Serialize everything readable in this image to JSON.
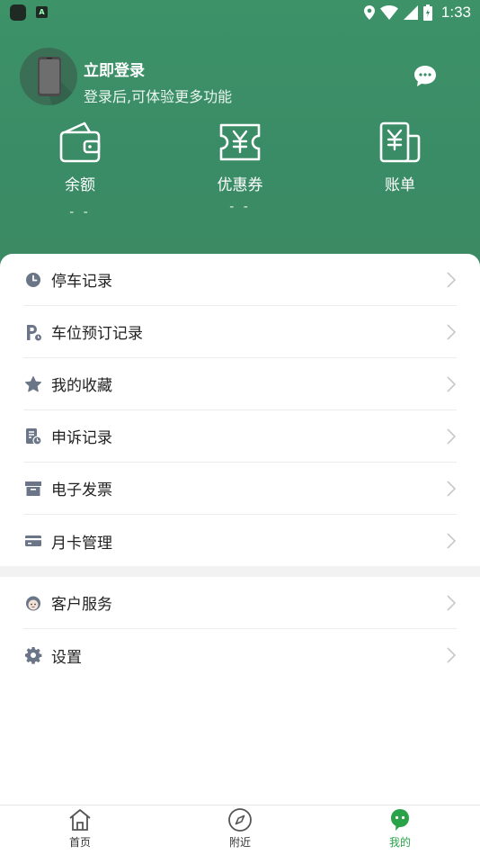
{
  "status_bar": {
    "time": "1:33",
    "app_badge": "A"
  },
  "profile": {
    "title": "立即登录",
    "subtitle": "登录后,可体验更多功能"
  },
  "wallet": [
    {
      "label": "余额",
      "value": "- -",
      "icon": "wallet-icon"
    },
    {
      "label": "优惠券",
      "value": "- -",
      "icon": "coupon-icon"
    },
    {
      "label": "账单",
      "value": "",
      "icon": "bill-icon"
    }
  ],
  "menu": [
    {
      "label": "停车记录",
      "icon": "clock-icon"
    },
    {
      "label": "车位预订记录",
      "icon": "parking-reserve-icon"
    },
    {
      "label": "我的收藏",
      "icon": "star-icon"
    },
    {
      "label": "申诉记录",
      "icon": "appeal-doc-icon"
    },
    {
      "label": "电子发票",
      "icon": "invoice-box-icon"
    },
    {
      "label": "月卡管理",
      "icon": "card-icon"
    }
  ],
  "menu2": [
    {
      "label": "客户服务",
      "icon": "customer-service-icon"
    },
    {
      "label": "设置",
      "icon": "gear-icon"
    }
  ],
  "tabs": [
    {
      "label": "首页",
      "icon": "home-icon"
    },
    {
      "label": "附近",
      "icon": "compass-icon"
    },
    {
      "label": "我的",
      "icon": "mine-icon"
    }
  ],
  "colors": {
    "header_green": "#3a8c66",
    "tab_active": "#2aa24a",
    "icon_gray": "#6b7588"
  }
}
